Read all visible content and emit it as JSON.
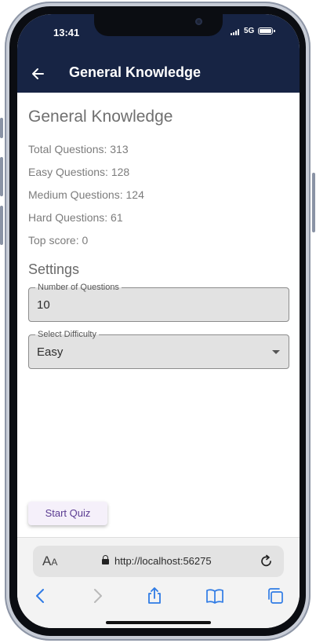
{
  "status_bar": {
    "time": "13:41",
    "network": "5G"
  },
  "app_bar": {
    "title": "General Knowledge",
    "back_icon": "arrow-left-icon"
  },
  "category": {
    "heading": "General Knowledge",
    "stats": [
      "Total Questions: 313",
      "Easy Questions: 128",
      "Medium Questions: 124",
      "Hard Questions: 61",
      "Top score: 0"
    ]
  },
  "settings": {
    "heading": "Settings",
    "num_questions": {
      "label": "Number of Questions",
      "value": "10"
    },
    "difficulty": {
      "label": "Select Difficulty",
      "value": "Easy"
    }
  },
  "actions": {
    "start_label": "Start Quiz"
  },
  "browser": {
    "text_size_label": "AA",
    "url": "http://localhost:56275",
    "icons": [
      "text-size-icon",
      "lock-icon",
      "reload-icon",
      "back-icon",
      "forward-icon",
      "share-icon",
      "bookmarks-icon",
      "tabs-icon"
    ]
  },
  "colors": {
    "app_bar": "#172444",
    "accent": "#5b3c92",
    "field_bg": "#e2e2e2",
    "browser_link": "#2f7be5"
  }
}
